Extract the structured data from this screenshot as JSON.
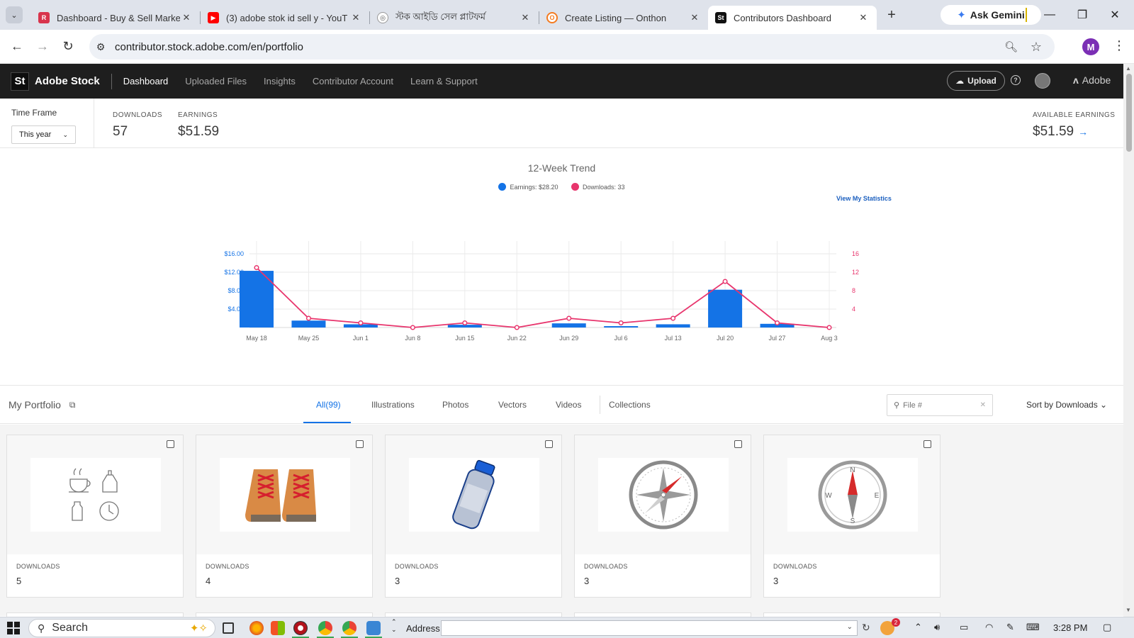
{
  "browser": {
    "tabs": [
      {
        "title": "Dashboard - Buy & Sell Marke",
        "favicon_color": "#d8344c",
        "favicon_letter": "R"
      },
      {
        "title": "(3) adobe stok id sell y - YouT",
        "favicon_color": "#ff0000",
        "favicon_letter": "▶"
      },
      {
        "title": "স্টক আইডি সেল প্লাটফর্ম",
        "favicon_color": "#666666",
        "favicon_letter": "◎"
      },
      {
        "title": "Create Listing — Onthon",
        "favicon_color": "#f47b20",
        "favicon_letter": "O"
      },
      {
        "title": "Contributors Dashboard",
        "favicon_color": "#111111",
        "favicon_letter": "St"
      }
    ],
    "new_tab": "+",
    "gemini_label": "Ask Gemini",
    "url": "contributor.stock.adobe.com/en/portfolio",
    "profile_initial": "M"
  },
  "header": {
    "logo": "St",
    "brand": "Adobe Stock",
    "nav": [
      "Dashboard",
      "Uploaded Files",
      "Insights",
      "Contributor Account",
      "Learn & Support"
    ],
    "upload_label": "Upload",
    "adobe_label": "Adobe"
  },
  "stats": {
    "timeframe_label": "Time Frame",
    "timeframe_value": "This year",
    "downloads_label": "DOWNLOADS",
    "downloads_value": "57",
    "earnings_label": "EARNINGS",
    "earnings_value": "$51.59",
    "available_label": "AVAILABLE EARNINGS",
    "available_value": "$51.59"
  },
  "trend": {
    "title": "12-Week Trend",
    "legend_earnings": "Earnings: $28.20",
    "legend_downloads": "Downloads: 33",
    "view_stats": "View My Statistics",
    "earnings_color": "#1473e6",
    "downloads_color": "#e8356d"
  },
  "chart_data": {
    "type": "bar",
    "categories": [
      "May 18",
      "May 25",
      "Jun 1",
      "Jun 8",
      "Jun 15",
      "Jun 22",
      "Jun 29",
      "Jul 6",
      "Jul 13",
      "Jul 20",
      "Jul 27",
      "Aug 3"
    ],
    "series": [
      {
        "name": "Earnings: $28.20",
        "type": "bar",
        "axis": "left",
        "values": [
          12.3,
          1.5,
          0.7,
          0,
          0.6,
          0,
          0.9,
          0.3,
          0.7,
          8.2,
          0.8,
          0
        ]
      },
      {
        "name": "Downloads: 33",
        "type": "line",
        "axis": "right",
        "values": [
          13,
          2,
          1,
          0,
          1,
          0,
          2,
          1,
          2,
          10,
          1,
          0
        ]
      }
    ],
    "left_ticks": [
      "$4.00",
      "$8.00",
      "$12.00",
      "$16.00"
    ],
    "left_tick_values": [
      4,
      8,
      12,
      16
    ],
    "right_ticks": [
      "4",
      "8",
      "12",
      "16"
    ],
    "right_tick_values": [
      4,
      8,
      12,
      16
    ],
    "ylim_left": [
      0,
      16
    ],
    "ylim_right": [
      0,
      16
    ],
    "grid": true
  },
  "portfolio": {
    "title": "My Portfolio",
    "tabs": [
      "All(99)",
      "Illustrations",
      "Photos",
      "Vectors",
      "Videos",
      "Collections"
    ],
    "search_placeholder": "File #",
    "sort_label": "Sort by Downloads ⌄",
    "download_label": "DOWNLOADS",
    "items": [
      {
        "downloads": "5",
        "thumb": "icons-line-art"
      },
      {
        "downloads": "4",
        "thumb": "boots"
      },
      {
        "downloads": "3",
        "thumb": "water-bottle"
      },
      {
        "downloads": "3",
        "thumb": "compass-safari"
      },
      {
        "downloads": "3",
        "thumb": "compass-nesw"
      }
    ]
  },
  "compass_letters": {
    "n": "N",
    "s": "S",
    "e": "E",
    "w": "W"
  },
  "taskbar": {
    "search_label": "Search",
    "address_label": "Address",
    "clock": "3:28 PM",
    "notif_count": "2"
  }
}
